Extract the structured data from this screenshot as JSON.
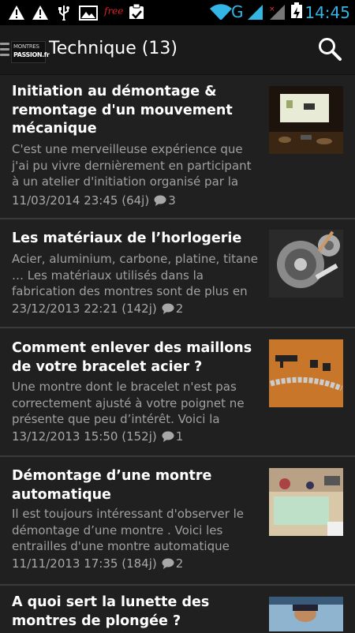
{
  "status_bar": {
    "time": "14:45",
    "network_label": "G",
    "icons": [
      "warning-icon",
      "warning-icon",
      "usb-icon",
      "image-icon",
      "free-icon",
      "clipboard-check-icon",
      "wifi-icon",
      "signal-icon",
      "signal-icon",
      "battery-charging-icon"
    ],
    "free_label": "free",
    "accent": "#33b5e5"
  },
  "action_bar": {
    "logo_line1": "MONTRES",
    "logo_line2": "PASSION.fr",
    "title": "Technique (13)",
    "search_icon": "search-icon"
  },
  "articles": [
    {
      "title": "Initiation au démontage & remontage d'un mouvement mécanique",
      "excerpt": "C'est une merveilleuse expérience que j'ai pu vivre dernièrement en participant à un atelier d'initiation organisé par la",
      "date": "11/03/2014 23:45 (64j)",
      "comments": "3"
    },
    {
      "title": "Les matériaux de l’horlogerie",
      "excerpt": "Acier, aluminium, carbone, platine, titane … Les matériaux utilisés dans la fabrication des montres sont de plus en",
      "date": "23/12/2013 22:21 (142j)",
      "comments": "2"
    },
    {
      "title": "Comment enlever des maillons de votre bracelet acier ?",
      "excerpt": "Une montre dont le bracelet n'est pas correctement ajusté à votre poignet ne présente que peu d’intérêt. Voici la",
      "date": "13/12/2013 15:50 (152j)",
      "comments": "1"
    },
    {
      "title": "Démontage d’une montre automatique",
      "excerpt": "Il est toujours intéressant d'observer le démontage d’une montre . Voici les entrailles d'une montre automatique",
      "date": "11/11/2013 17:35 (184j)",
      "comments": "2"
    },
    {
      "title": "A quoi sert la lunette des montres de plongée ?",
      "excerpt": "",
      "date": "",
      "comments": ""
    }
  ]
}
